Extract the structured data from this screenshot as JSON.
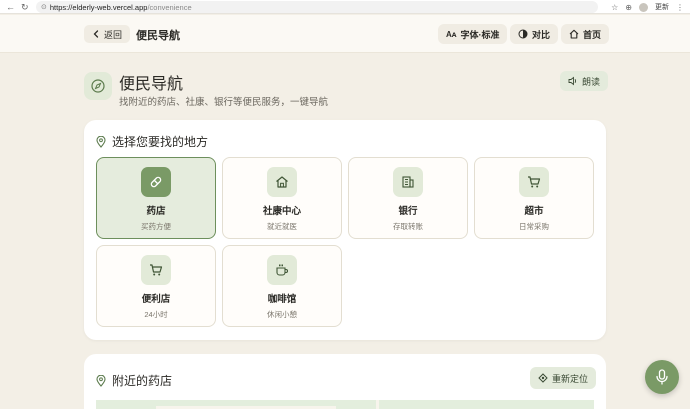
{
  "browser": {
    "url_host": "https://elderly-web.vercel.app",
    "url_path": "/convenience",
    "update_label": "更新"
  },
  "header": {
    "back_label": "返回",
    "title": "便民导航",
    "font_label": "字体·标准",
    "contrast_label": "对比",
    "home_label": "首页"
  },
  "page": {
    "title": "便民导航",
    "subtitle": "找附近的药店、社康、银行等便民服务，一键导航",
    "read_label": "朗读"
  },
  "select_card": {
    "heading": "选择您要找的地方",
    "tiles": [
      {
        "name": "药店",
        "desc": "买药方便",
        "icon": "pill-icon",
        "selected": true
      },
      {
        "name": "社康中心",
        "desc": "就近就医",
        "icon": "home-icon",
        "selected": false
      },
      {
        "name": "银行",
        "desc": "存取转账",
        "icon": "bank-icon",
        "selected": false
      },
      {
        "name": "超市",
        "desc": "日常采购",
        "icon": "cart-icon",
        "selected": false
      },
      {
        "name": "便利店",
        "desc": "24小时",
        "icon": "cart-icon",
        "selected": false
      },
      {
        "name": "咖啡馆",
        "desc": "休闲小憩",
        "icon": "coffee-icon",
        "selected": false
      }
    ]
  },
  "nearby_card": {
    "heading": "附近的药店",
    "relocate_label": "重新定位"
  },
  "colors": {
    "accent": "#7a9a66",
    "accent_light": "#e2ead8",
    "background": "#f3efe6"
  }
}
